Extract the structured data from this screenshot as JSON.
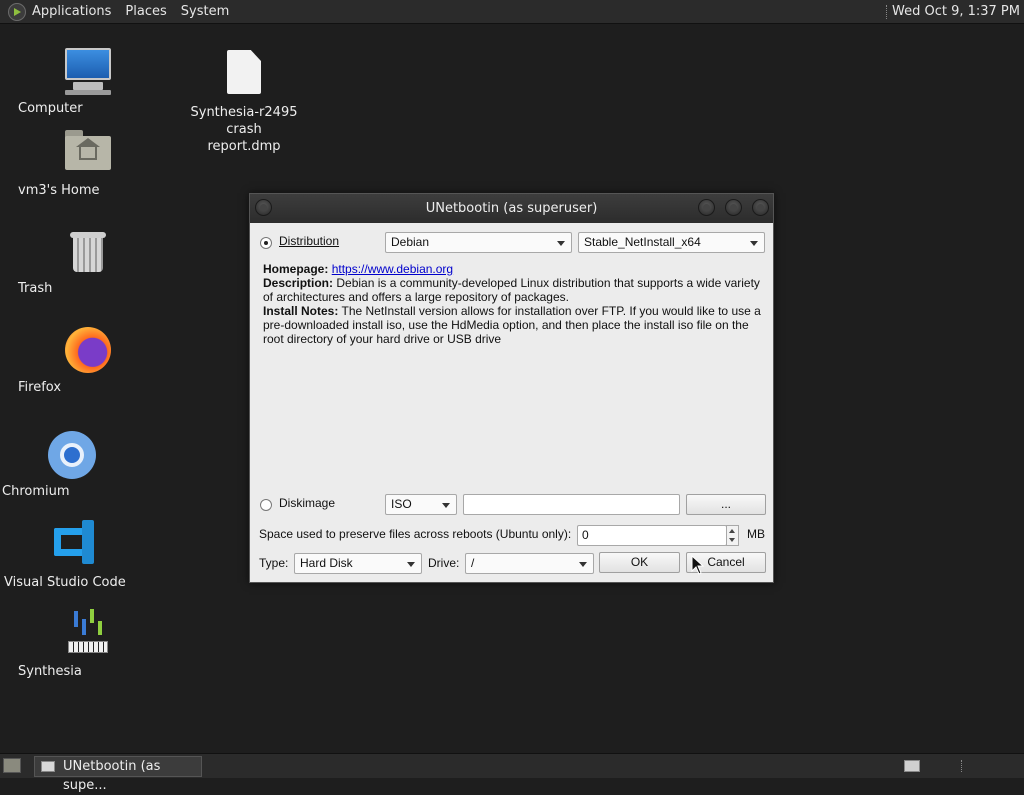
{
  "top_panel": {
    "menus": [
      "Applications",
      "Places",
      "System"
    ],
    "clock": "Wed Oct  9,  1:37 PM"
  },
  "desktop": {
    "icons": [
      {
        "label": "Computer",
        "icon": "computer-icon"
      },
      {
        "label": "Synthesia-r2495 crash report.dmp",
        "icon": "file-icon"
      },
      {
        "label": "vm3's Home",
        "icon": "home-folder-icon"
      },
      {
        "label": "Trash",
        "icon": "trash-icon"
      },
      {
        "label": "Firefox",
        "icon": "firefox-icon"
      },
      {
        "label": "Chromium",
        "icon": "chromium-icon"
      },
      {
        "label": "Visual Studio Code",
        "icon": "vscode-icon"
      },
      {
        "label": "Synthesia",
        "icon": "synthesia-icon"
      }
    ],
    "file_label_line1": "Synthesia-r2495 crash",
    "file_label_line2": "report.dmp"
  },
  "dialog": {
    "title": "UNetbootin (as superuser)",
    "distribution_label": "Distribution",
    "distribution_selected": true,
    "distribution_value": "Debian",
    "version_value": "Stable_NetInstall_x64",
    "homepage_label": "Homepage:",
    "homepage_url": "https://www.debian.org",
    "description_label": "Description:",
    "description_text": "Debian is a community-developed Linux distribution that supports a wide variety of architectures and offers a large repository of packages.",
    "install_notes_label": "Install Notes:",
    "install_notes_text": "The NetInstall version allows for installation over FTP. If you would like to use a pre-downloaded install iso, use the HdMedia option, and then place the install iso file on the root directory of your hard drive or USB drive",
    "diskimage_label": "Diskimage",
    "diskimage_selected": false,
    "diskimage_format": "ISO",
    "diskimage_path": "",
    "browse_label": "...",
    "persist_label": "Space used to preserve files across reboots (Ubuntu only):",
    "persist_value": "0",
    "persist_unit": "MB",
    "type_label": "Type:",
    "type_value": "Hard Disk",
    "drive_label": "Drive:",
    "drive_value": "/",
    "ok_label": "OK",
    "cancel_label": "Cancel"
  },
  "taskbar": {
    "task_label": "UNetbootin (as supe..."
  },
  "colors": {
    "desktop_bg": "#1e1e1e",
    "panel_bg": "#2b2b2b",
    "dialog_bg": "#ececec",
    "link": "#0000cc"
  }
}
